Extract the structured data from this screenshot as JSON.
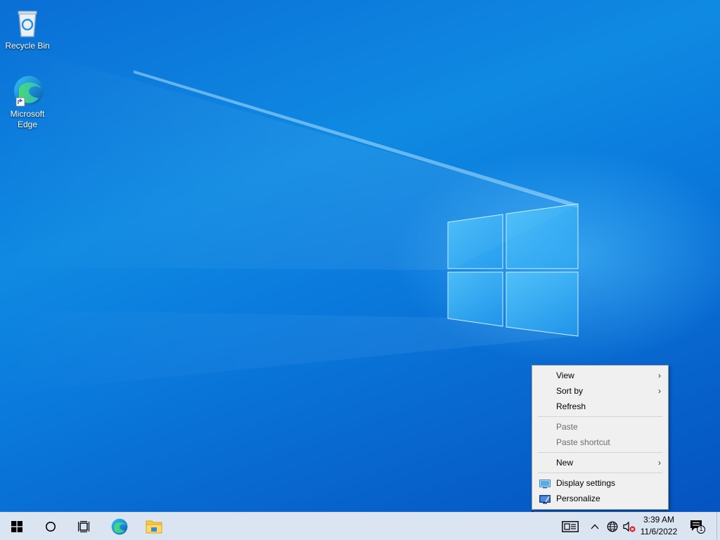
{
  "desktop": {
    "icons": [
      {
        "label": "Recycle Bin",
        "icon": "recycle-bin-icon"
      },
      {
        "label": "Microsoft Edge",
        "icon": "edge-icon"
      }
    ]
  },
  "context_menu": {
    "items": [
      {
        "label": "View",
        "submenu": true,
        "enabled": true
      },
      {
        "label": "Sort by",
        "submenu": true,
        "enabled": true
      },
      {
        "label": "Refresh",
        "submenu": false,
        "enabled": true
      },
      {
        "label": "Paste",
        "submenu": false,
        "enabled": false
      },
      {
        "label": "Paste shortcut",
        "submenu": false,
        "enabled": false
      },
      {
        "label": "New",
        "submenu": true,
        "enabled": true
      },
      {
        "label": "Display settings",
        "submenu": false,
        "enabled": true,
        "icon": "display-icon"
      },
      {
        "label": "Personalize",
        "submenu": false,
        "enabled": true,
        "icon": "personalize-icon"
      }
    ],
    "submenu_arrow": "›"
  },
  "taskbar": {
    "buttons": [
      "start-icon",
      "search-icon",
      "task-view-icon",
      "edge-icon",
      "file-explorer-icon"
    ],
    "tray": {
      "time": "3:39 AM",
      "date": "11/6/2022",
      "notification_count": "1"
    }
  },
  "colors": {
    "taskbar_bg": "#dae5f1",
    "menu_bg": "#f0f0f0",
    "accent": "#0078d7"
  }
}
